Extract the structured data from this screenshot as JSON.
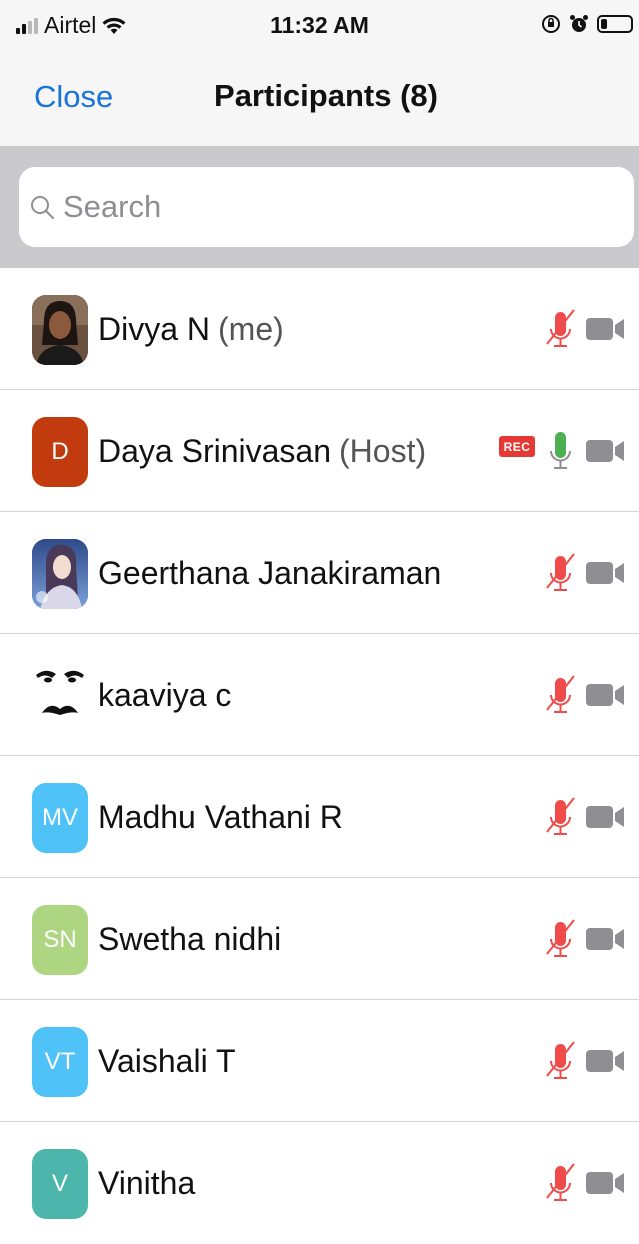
{
  "status_bar": {
    "carrier": "Airtel",
    "time": "11:32 AM",
    "battery_level": 0.2
  },
  "nav": {
    "close_label": "Close",
    "title": "Participants (8)"
  },
  "search": {
    "placeholder": "Search",
    "value": ""
  },
  "colors": {
    "accent": "#1a73d9",
    "muted_mic": "#ef4b4b",
    "active_mic": "#4caf50",
    "camera_off": "#8e8e93",
    "rec_badge": "#e53935"
  },
  "participants": [
    {
      "name": "Divya N",
      "role": "(me)",
      "initials": "",
      "avatar_type": "photo-woman",
      "avatar_color": "#5d4a3a",
      "mic": "muted",
      "camera": "off",
      "recording": false
    },
    {
      "name": "Daya Srinivasan",
      "role": "(Host)",
      "initials": "D",
      "avatar_type": "initials",
      "avatar_color": "#c23b0f",
      "mic": "on",
      "camera": "off",
      "recording": true,
      "rec_label": "REC"
    },
    {
      "name": "Geerthana Janakiraman",
      "role": "",
      "initials": "",
      "avatar_type": "photo-anime",
      "avatar_color": "#3e5b9a",
      "mic": "muted",
      "camera": "off",
      "recording": false
    },
    {
      "name": "kaaviya c",
      "role": "",
      "initials": "",
      "avatar_type": "face-drawing",
      "avatar_color": "#ffffff",
      "mic": "muted",
      "camera": "off",
      "recording": false
    },
    {
      "name": "Madhu Vathani R",
      "role": "",
      "initials": "MV",
      "avatar_type": "initials",
      "avatar_color": "#4fc3f7",
      "mic": "muted",
      "camera": "off",
      "recording": false
    },
    {
      "name": "Swetha nidhi",
      "role": "",
      "initials": "SN",
      "avatar_type": "initials",
      "avatar_color": "#aed581",
      "mic": "muted",
      "camera": "off",
      "recording": false
    },
    {
      "name": "Vaishali T",
      "role": "",
      "initials": "VT",
      "avatar_type": "initials",
      "avatar_color": "#4fc3f7",
      "mic": "muted",
      "camera": "off",
      "recording": false
    },
    {
      "name": "Vinitha",
      "role": "",
      "initials": "V",
      "avatar_type": "initials",
      "avatar_color": "#4db6ac",
      "mic": "muted",
      "camera": "off",
      "recording": false
    }
  ]
}
